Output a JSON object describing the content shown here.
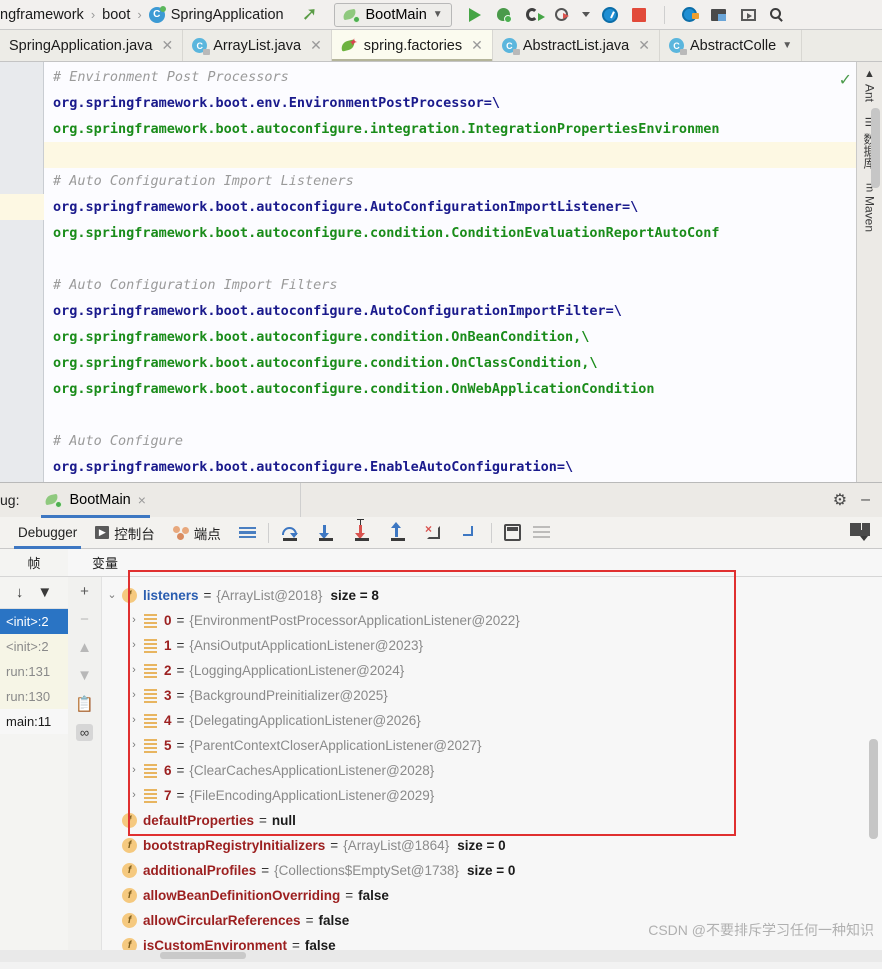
{
  "topbar": {
    "breadcrumb": [
      "ngframework",
      "boot",
      "SpringApplication"
    ],
    "breadcrumb_icon": "class-icon",
    "up_arrow": "navigate-up-icon",
    "run_config": "BootMain",
    "icons": [
      "run-icon",
      "debug-icon",
      "run-with-coverage-icon",
      "profiler-icon",
      "profiler-dropdown-icon",
      "performance-icon",
      "stop-icon",
      "endpoints-icon",
      "project-structure-icon",
      "run-anything-icon",
      "search-icon"
    ]
  },
  "tabs": [
    {
      "label": "SpringApplication.java",
      "icon": "java-class-icon",
      "active": false,
      "closable": true
    },
    {
      "label": "ArrayList.java",
      "icon": "java-class-icon",
      "active": false,
      "closable": true
    },
    {
      "label": "spring.factories",
      "icon": "spring-icon",
      "active": true,
      "closable": true
    },
    {
      "label": "AbstractList.java",
      "icon": "java-class-icon",
      "active": false,
      "closable": true
    },
    {
      "label": "AbstractColle",
      "icon": "java-class-icon",
      "active": false,
      "closable": false
    }
  ],
  "tab_overflow": "▼",
  "editor": {
    "lines": [
      {
        "text": "# Environment Post Processors",
        "type": "cmt"
      },
      {
        "text": "org.springframework.boot.env.EnvironmentPostProcessor=\\",
        "type": "key"
      },
      {
        "text": "org.springframework.boot.autoconfigure.integration.IntegrationPropertiesEnvironmen",
        "type": "val"
      },
      {
        "text": "",
        "type": "blank-hl"
      },
      {
        "text": "# Auto Configuration Import Listeners",
        "type": "cmt"
      },
      {
        "text": "org.springframework.boot.autoconfigure.AutoConfigurationImportListener=\\",
        "type": "key"
      },
      {
        "text": "org.springframework.boot.autoconfigure.condition.ConditionEvaluationReportAutoConf",
        "type": "val"
      },
      {
        "text": "",
        "type": "blank"
      },
      {
        "text": "# Auto Configuration Import Filters",
        "type": "cmt"
      },
      {
        "text": "org.springframework.boot.autoconfigure.AutoConfigurationImportFilter=\\",
        "type": "key"
      },
      {
        "text": "org.springframework.boot.autoconfigure.condition.OnBeanCondition,\\",
        "type": "val"
      },
      {
        "text": "org.springframework.boot.autoconfigure.condition.OnClassCondition,\\",
        "type": "val"
      },
      {
        "text": "org.springframework.boot.autoconfigure.condition.OnWebApplicationCondition",
        "type": "val"
      },
      {
        "text": "",
        "type": "blank"
      },
      {
        "text": "# Auto Configure",
        "type": "cmt"
      },
      {
        "text": "org.springframework.boot.autoconfigure.EnableAutoConfiguration=\\",
        "type": "key"
      }
    ],
    "inspection_status": "✓"
  },
  "right_strip": [
    {
      "label": "Ant",
      "icon": "ant-icon"
    },
    {
      "label": "数据库",
      "icon": "database-icon"
    },
    {
      "label": "Maven",
      "icon": "maven-icon"
    }
  ],
  "debug": {
    "panel_label": "ug:",
    "session_tab": "BootMain",
    "session_icon": "spring-boot-icon",
    "close_label": "×",
    "gear_icon": "settings-gear-icon",
    "minimize_icon": "minimize-icon",
    "tabs": [
      {
        "label": "Debugger",
        "icon": "",
        "active": true
      },
      {
        "label": "控制台",
        "icon": "console-icon",
        "active": false
      },
      {
        "label": "端点",
        "icon": "endpoints-icon",
        "active": false
      }
    ],
    "step_icons": [
      "step-over-icon",
      "step-into-icon",
      "force-step-into-icon",
      "step-out-icon",
      "drop-frame-icon",
      "run-to-cursor-icon"
    ],
    "right_icons": [
      "evaluate-expression-icon",
      "sort-values-icon",
      "layout-settings-icon"
    ]
  },
  "frames": {
    "header": "帧",
    "toolbar_icons": [
      "thread-dump-icon",
      "filter-icon"
    ],
    "items": [
      {
        "label": "<init>:2",
        "state": "selected"
      },
      {
        "label": "<init>:2",
        "state": "library"
      },
      {
        "label": "run:131",
        "state": "library"
      },
      {
        "label": "run:130",
        "state": "library"
      },
      {
        "label": "main:11",
        "state": "user"
      }
    ]
  },
  "variables": {
    "header": "变量",
    "toolbar_icons": [
      "add-watch-icon",
      "remove-watch-icon",
      "move-up-icon",
      "move-down-icon",
      "copy-icon",
      "inspect-icon"
    ],
    "rows": [
      {
        "twisty": "⌄",
        "badge": "f",
        "name": "listeners",
        "name_color": "blue",
        "value": "{ArrayList@2018}",
        "size": "size = 8",
        "indent": 0
      },
      {
        "twisty": "›",
        "badge": "list",
        "name": "0",
        "value": "{EnvironmentPostProcessorApplicationListener@2022}",
        "indent": 1
      },
      {
        "twisty": "›",
        "badge": "list",
        "name": "1",
        "value": "{AnsiOutputApplicationListener@2023}",
        "indent": 1
      },
      {
        "twisty": "›",
        "badge": "list",
        "name": "2",
        "value": "{LoggingApplicationListener@2024}",
        "indent": 1
      },
      {
        "twisty": "›",
        "badge": "list",
        "name": "3",
        "value": "{BackgroundPreinitializer@2025}",
        "indent": 1
      },
      {
        "twisty": "›",
        "badge": "list",
        "name": "4",
        "value": "{DelegatingApplicationListener@2026}",
        "indent": 1
      },
      {
        "twisty": "›",
        "badge": "list",
        "name": "5",
        "value": "{ParentContextCloserApplicationListener@2027}",
        "indent": 1
      },
      {
        "twisty": "›",
        "badge": "list",
        "name": "6",
        "value": "{ClearCachesApplicationListener@2028}",
        "indent": 1
      },
      {
        "twisty": "›",
        "badge": "list",
        "name": "7",
        "value": "{FileEncodingApplicationListener@2029}",
        "indent": 1
      },
      {
        "twisty": "",
        "badge": "f",
        "name": "defaultProperties",
        "value": "null",
        "value_style": "black",
        "indent": 0
      },
      {
        "twisty": "",
        "badge": "f",
        "name": "bootstrapRegistryInitializers",
        "value": "{ArrayList@1864}",
        "size": "size = 0",
        "indent": 0
      },
      {
        "twisty": "",
        "badge": "f",
        "name": "additionalProfiles",
        "value": "{Collections$EmptySet@1738}",
        "size": "size = 0",
        "indent": 0
      },
      {
        "twisty": "",
        "badge": "f",
        "name": "allowBeanDefinitionOverriding",
        "value": "false",
        "value_style": "black",
        "indent": 0
      },
      {
        "twisty": "",
        "badge": "f",
        "name": "allowCircularReferences",
        "value": "false",
        "value_style": "black",
        "indent": 0
      },
      {
        "twisty": "",
        "badge": "f",
        "name": "isCustomEnvironment",
        "value": "false",
        "value_style": "black",
        "indent": 0
      }
    ]
  },
  "watermark": "CSDN @不要排斥学习任何一种知识",
  "colors": {
    "accent_blue": "#2a74c4",
    "highlight_red": "#e03030",
    "comment_gray": "#9a9a9a",
    "key_navy": "#1a1a8c",
    "value_green": "#1a8c1a",
    "field_maroon": "#9c2020"
  }
}
